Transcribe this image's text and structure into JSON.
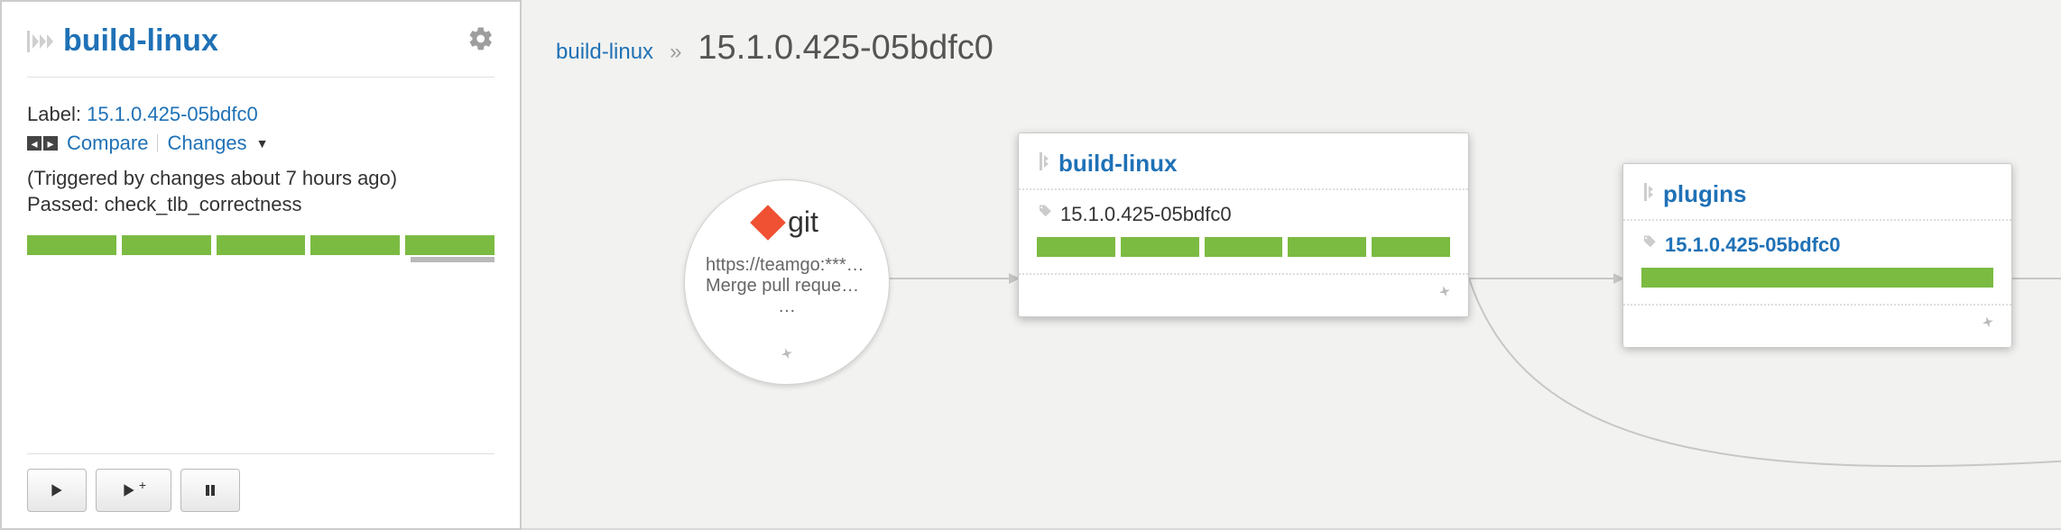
{
  "left": {
    "title": "build-linux",
    "label_key": "Label:",
    "label_value": "15.1.0.425-05bdfc0",
    "compare": "Compare",
    "changes": "Changes",
    "trigger_line": "(Triggered by changes about 7 hours ago)",
    "passed_line": "Passed: check_tlb_correctness",
    "play_plus_suffix": "+"
  },
  "breadcrumb": {
    "link": "build-linux",
    "sep": "»",
    "current": "15.1.0.425-05bdfc0"
  },
  "git": {
    "name": "git",
    "url": "https://teamgo:*****…",
    "msg": "Merge pull request #…",
    "dots": "…"
  },
  "build_card": {
    "title": "build-linux",
    "tag": "15.1.0.425-05bdfc0",
    "stage_count": 5
  },
  "plugins_card": {
    "title": "plugins",
    "tag": "15.1.0.425-05bdfc0",
    "stage_count": 1
  },
  "colors": {
    "accent": "#1f71b6",
    "pass": "#7bbb42",
    "git": "#f05133"
  }
}
